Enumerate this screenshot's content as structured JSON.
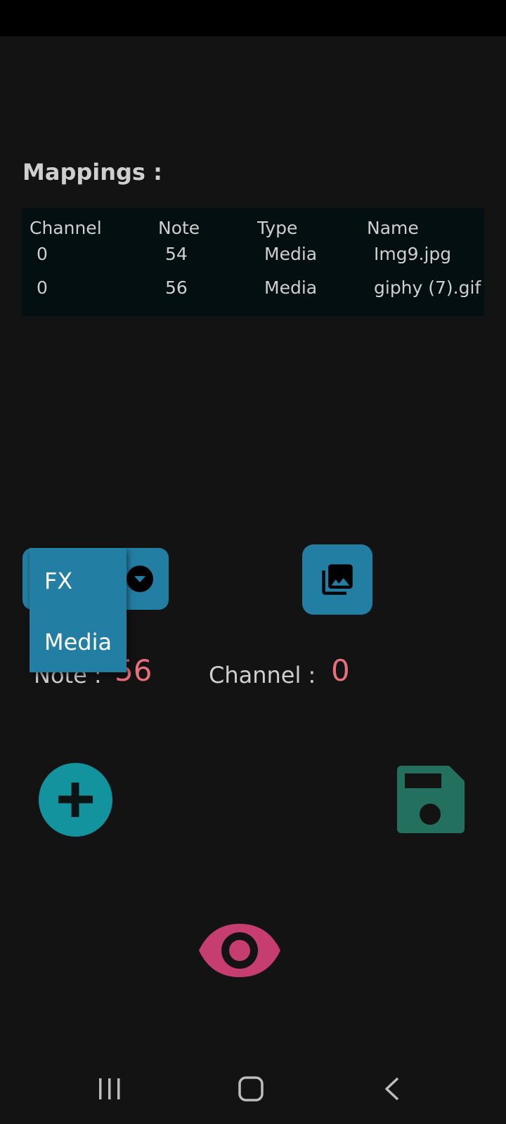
{
  "mappings": {
    "title": "Mappings :",
    "columns": [
      "Channel",
      "Note",
      "Type",
      "Name"
    ],
    "rows": [
      {
        "channel": "0",
        "note": "54",
        "type": "Media",
        "name": "Img9.jpg"
      },
      {
        "channel": "0",
        "note": "56",
        "type": "Media",
        "name": "giphy (7).gif"
      }
    ]
  },
  "type_dropdown": {
    "options": [
      "FX",
      "Media"
    ]
  },
  "info": {
    "note_label": "Note :",
    "note_value": "56",
    "channel_label": "Channel :",
    "channel_value": "0"
  },
  "icons": {
    "gallery": "photo-library-icon",
    "add": "add-icon",
    "save": "save-icon",
    "preview": "eye-icon",
    "dropdown": "dropdown-arrow-icon"
  },
  "colors": {
    "background": "#131313",
    "accent_blue": "#237ea4",
    "add_teal": "#12939d",
    "save_green": "#23705f",
    "eye_pink": "#c63d70",
    "value_red": "#e8707a"
  }
}
